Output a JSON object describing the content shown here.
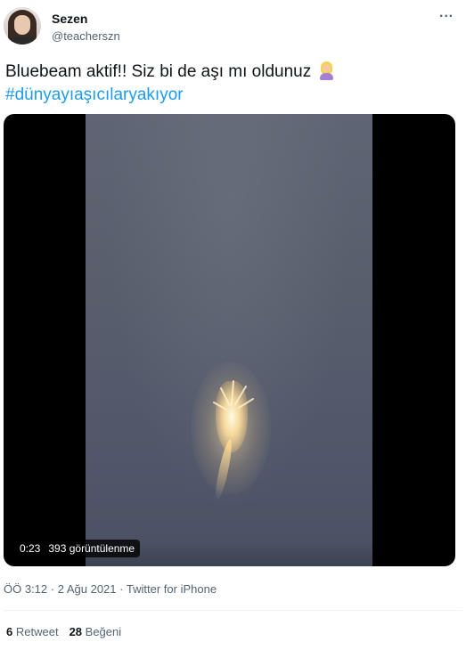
{
  "author": {
    "name": "Sezen",
    "handle": "@teacherszn",
    "avatar_icon": "profile-photo-avatar"
  },
  "more_icon": "···",
  "tweet": {
    "text": "Bluebeam aktif!! Siz bi de aşı mı oldunuz ",
    "emoji_icon": "woman-facepalming-emoji",
    "hashtag": "#dünyayıaşıcılaryakıyor"
  },
  "video": {
    "duration": "0:23",
    "views": "393 görüntülenme"
  },
  "meta": {
    "time": "ÖÖ 3:12",
    "separator1": "·",
    "date": "2 Ağu 2021",
    "separator2": "·",
    "source": "Twitter for iPhone"
  },
  "stats": {
    "retweet_count": "6",
    "retweet_label": "Retweet",
    "like_count": "28",
    "like_label": "Beğeni"
  },
  "colors": {
    "link": "#1d9bf0",
    "secondary_text": "#536471",
    "primary_text": "#0f1419"
  }
}
